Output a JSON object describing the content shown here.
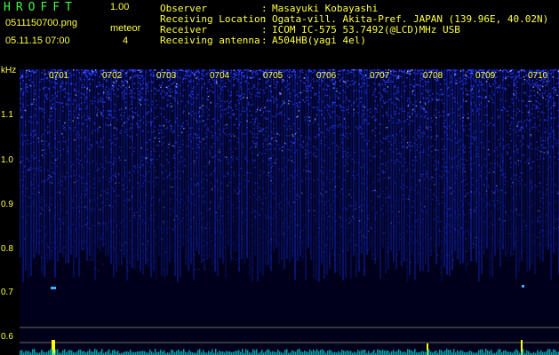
{
  "app": {
    "title": "HROFFT",
    "version": "1.00"
  },
  "file": {
    "name": "0511150700.png",
    "datetime": "05.11.15 07:00"
  },
  "meteor": {
    "label": "meteor",
    "count": "4"
  },
  "station": [
    {
      "key": "Observer",
      "value": "Masayuki Kobayashi"
    },
    {
      "key": "Receiving Location",
      "value": "Ogata-vill. Akita-Pref. JAPAN (139.96E, 40.02N)"
    },
    {
      "key": "Receiver",
      "value": "ICOM IC-575 53.7492(@LCD)MHz USB"
    },
    {
      "key": "Receiving antenna",
      "value": "A504HB(yagi 4el)"
    }
  ],
  "spectrogram": {
    "y_unit": "kHz",
    "y_labels": [
      "1.1",
      "1.0",
      "0.9",
      "0.8",
      "0.7",
      "0.6"
    ],
    "time_labels": [
      "0701",
      "0702",
      "0703",
      "0704",
      "0705",
      "0706",
      "0707",
      "0708",
      "0709",
      "0710"
    ],
    "colors": {
      "noise": "#2a3cff",
      "axis": "#ffff40",
      "echo": "#ffff00",
      "baseline": "#00c8c8"
    }
  }
}
